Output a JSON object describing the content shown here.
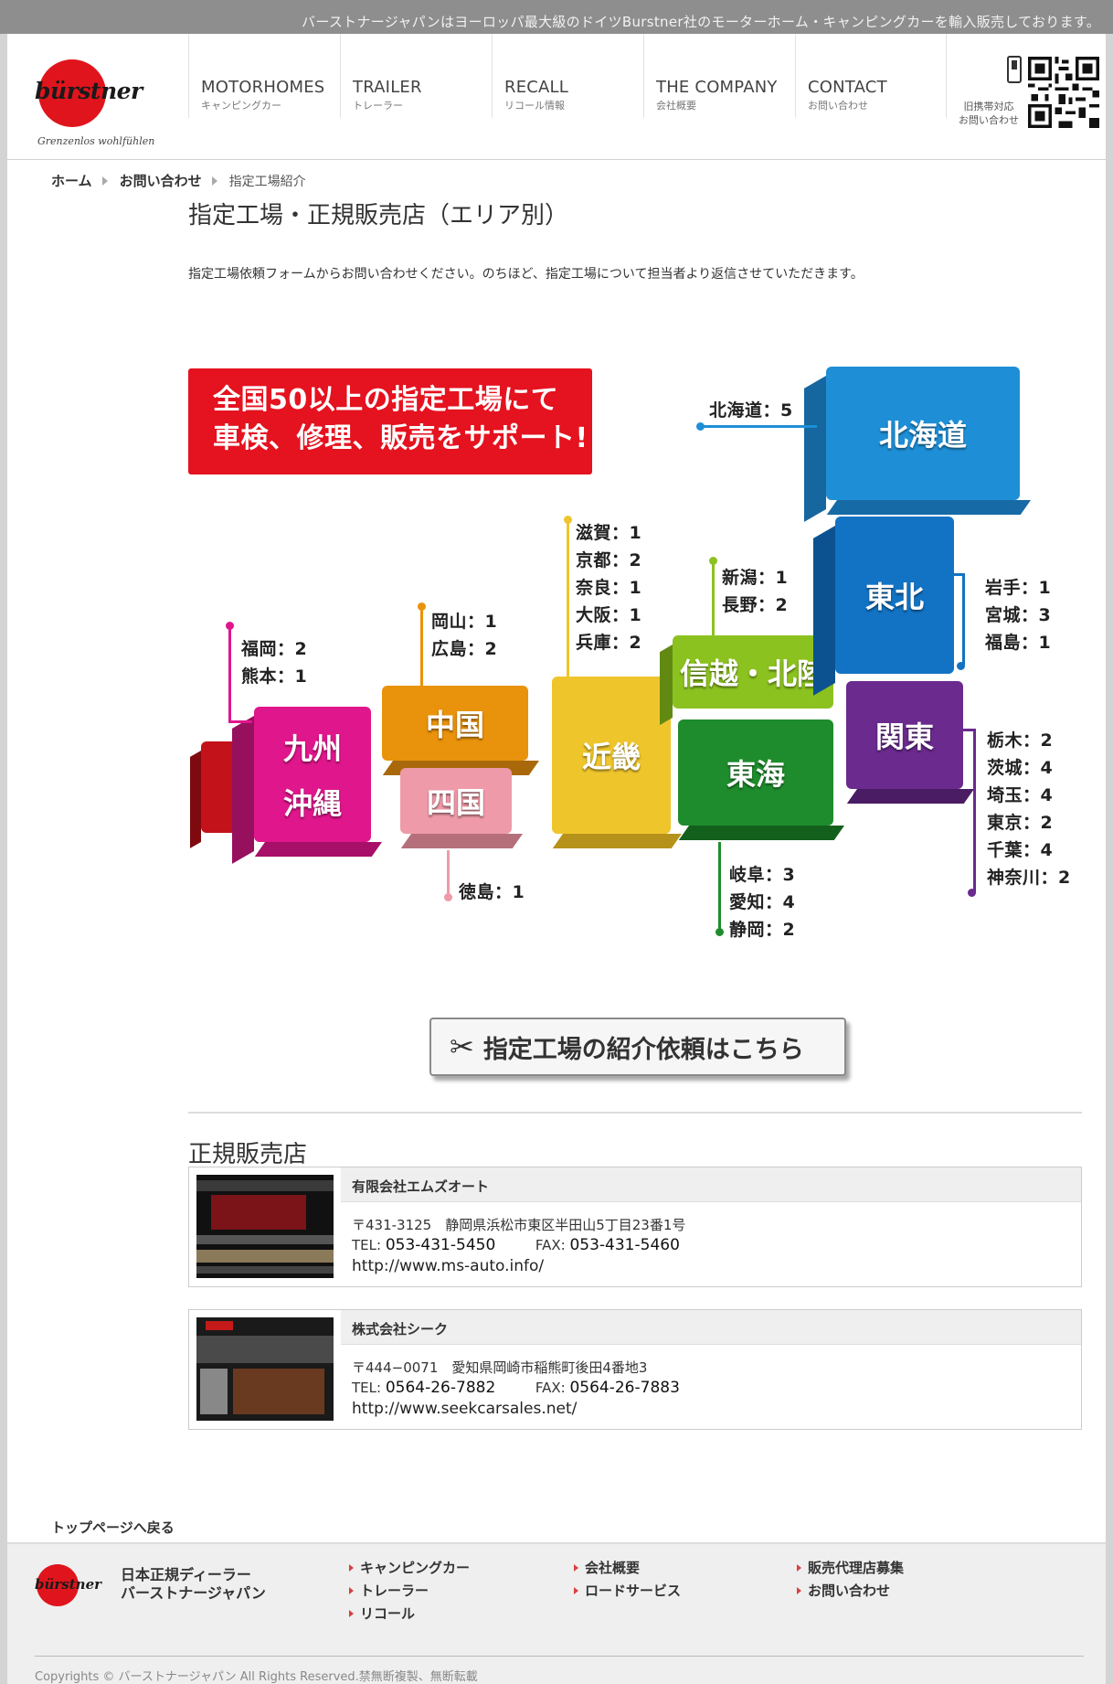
{
  "top_message": "バーストナージャパンはヨーロッパ最大級のドイツBurstner社のモーターホーム・キャンピングカーを輸入販売しております。",
  "logo": {
    "word": "bürstner",
    "tagline": "Grenzenlos wohlfühlen"
  },
  "nav": [
    {
      "en": "MOTORHOMES",
      "jp": "キャンピングカー"
    },
    {
      "en": "TRAILER",
      "jp": "トレーラー"
    },
    {
      "en": "RECALL",
      "jp": "リコール情報"
    },
    {
      "en": "THE COMPANY",
      "jp": "会社概要"
    },
    {
      "en": "CONTACT",
      "jp": "お問い合わせ"
    }
  ],
  "mobile": {
    "line1": "旧携帯対応",
    "line2": "お問い合わせ"
  },
  "breadcrumb": {
    "home": "ホーム",
    "contact": "お問い合わせ",
    "current": "指定工場紹介"
  },
  "page_title": "指定工場・正規販売店（エリア別）",
  "intro": "指定工場依頼フォームからお問い合わせください。のちほど、指定工場について担当者より返信させていただきます。",
  "banner": {
    "line1": "全国50以上の指定工場にて",
    "line2": "車検、修理、販売をサポート!"
  },
  "regions": {
    "hokkaido": {
      "name": "北海道",
      "color": "#1e8fd6"
    },
    "tohoku": {
      "name": "東北",
      "color": "#1273c4"
    },
    "kanto": {
      "name": "関東",
      "color": "#6a2a8e"
    },
    "shinetsu": {
      "name": "信越・北陸",
      "color": "#8cc21f"
    },
    "tokai": {
      "name": "東海",
      "color": "#1e8c2c"
    },
    "kinki": {
      "name": "近畿",
      "color": "#efc52c"
    },
    "chugoku": {
      "name": "中国",
      "color": "#e9920c"
    },
    "shikoku": {
      "name": "四国",
      "color": "#ef9aa8"
    },
    "kyushu": {
      "name": "九州",
      "color": "#e0168c"
    },
    "okinawa": {
      "name": "沖縄",
      "color": "#c4121a"
    }
  },
  "callouts": {
    "hokkaido": [
      "北海道：5"
    ],
    "tohoku": [
      "岩手：1",
      "宮城：3",
      "福島：1"
    ],
    "kanto": [
      "栃木：2",
      "茨城：4",
      "埼玉：4",
      "東京：2",
      "千葉：4",
      "神奈川：2"
    ],
    "shinetsu": [
      "新潟：1",
      "長野：2"
    ],
    "tokai": [
      "岐阜：3",
      "愛知：4",
      "静岡：2"
    ],
    "kinki": [
      "滋賀：1",
      "京都：2",
      "奈良：1",
      "大阪：1",
      "兵庫：2"
    ],
    "chugoku": [
      "岡山：1",
      "広島：2"
    ],
    "shikoku": [
      "徳島：1"
    ],
    "kyushu": [
      "福岡：2",
      "熊本：1"
    ]
  },
  "cta_label": "指定工場の紹介依頼はこちら",
  "dealers_title": "正規販売店",
  "dealers": [
    {
      "name": "有限会社エムズオート",
      "address": "〒431-3125　静岡県浜松市東区半田山5丁目23番1号",
      "tel_label": "TEL:",
      "tel": "053-431-5450",
      "fax_label": "FAX:",
      "fax": "053-431-5460",
      "url": "http://www.ms-auto.info/"
    },
    {
      "name": "株式会社シーク",
      "address": "〒444−0071　愛知県岡崎市稲熊町後田4番地3",
      "tel_label": "TEL:",
      "tel": "0564-26-7882",
      "fax_label": "FAX:",
      "fax": "0564-26-7883",
      "url": "http://www.seekcarsales.net/"
    }
  ],
  "back_top": "トップページへ戻る",
  "footer": {
    "company_line1": "日本正規ディーラー",
    "company_line2": "バーストナージャパン",
    "col1": [
      "キャンピングカー",
      "トレーラー",
      "リコール"
    ],
    "col2": [
      "会社概要",
      "ロードサービス"
    ],
    "col3": [
      "販売代理店募集",
      "お問い合わせ"
    ],
    "copyright": "Copyrights © バーストナージャパン All Rights Reserved.禁無断複製、無断転載"
  }
}
